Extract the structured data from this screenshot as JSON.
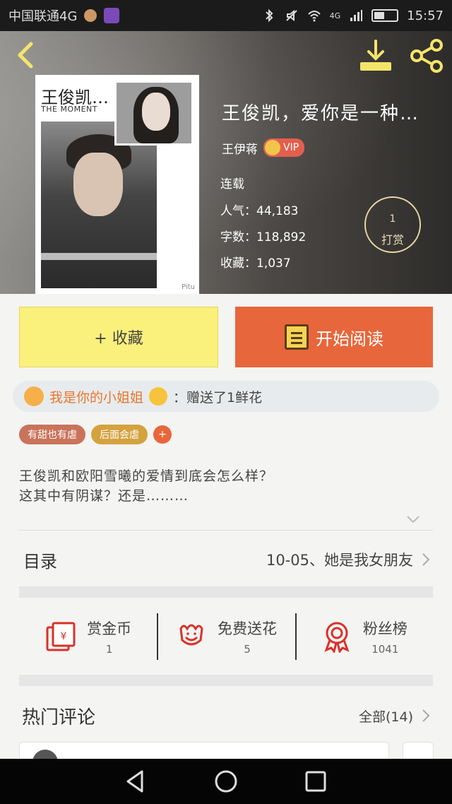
{
  "status_bar": {
    "carrier": "中国联通4G",
    "time": "15:57",
    "network": "4G"
  },
  "book": {
    "title": "王俊凯，爱你是一种…",
    "author": "王伊蒋",
    "vip_label": "VIP",
    "status": "连载",
    "popularity": "人气：44,183",
    "word_count": "字数：118,892",
    "favorites": "收藏：1,037",
    "cover_title": "王俊凯…",
    "cover_subtitle": "THE MOMENT",
    "cover_tag": "Pitu"
  },
  "reward": {
    "count": "1",
    "label": "打赏"
  },
  "actions": {
    "collect_label": "+ 收藏",
    "read_label": "开始阅读"
  },
  "notice": {
    "user": "我是你的小姐姐",
    "text": "：赠送了1鲜花"
  },
  "tags": [
    "有甜也有虐",
    "后面会虐"
  ],
  "tag_add": "+",
  "summary": {
    "line1": "王俊凯和欧阳雪曦的爱情到底会怎么样？",
    "line2": "这其中有阴谋？还是………"
  },
  "toc": {
    "label": "目录",
    "latest": "10-05、她是我女朋友"
  },
  "stats": [
    {
      "name": "赏金币",
      "value": "1",
      "icon": "red-envelope-icon"
    },
    {
      "name": "免费送花",
      "value": "5",
      "icon": "flower-icon"
    },
    {
      "name": "粉丝榜",
      "value": "1041",
      "icon": "medal-icon"
    }
  ],
  "comments": {
    "title": "热门评论",
    "all_label": "全部(14)"
  },
  "colors": {
    "accent_orange": "#e8663b",
    "collect_yellow": "#faf07c",
    "icon_red": "#d8322a",
    "header_icon_yellow": "#f3e56a"
  }
}
